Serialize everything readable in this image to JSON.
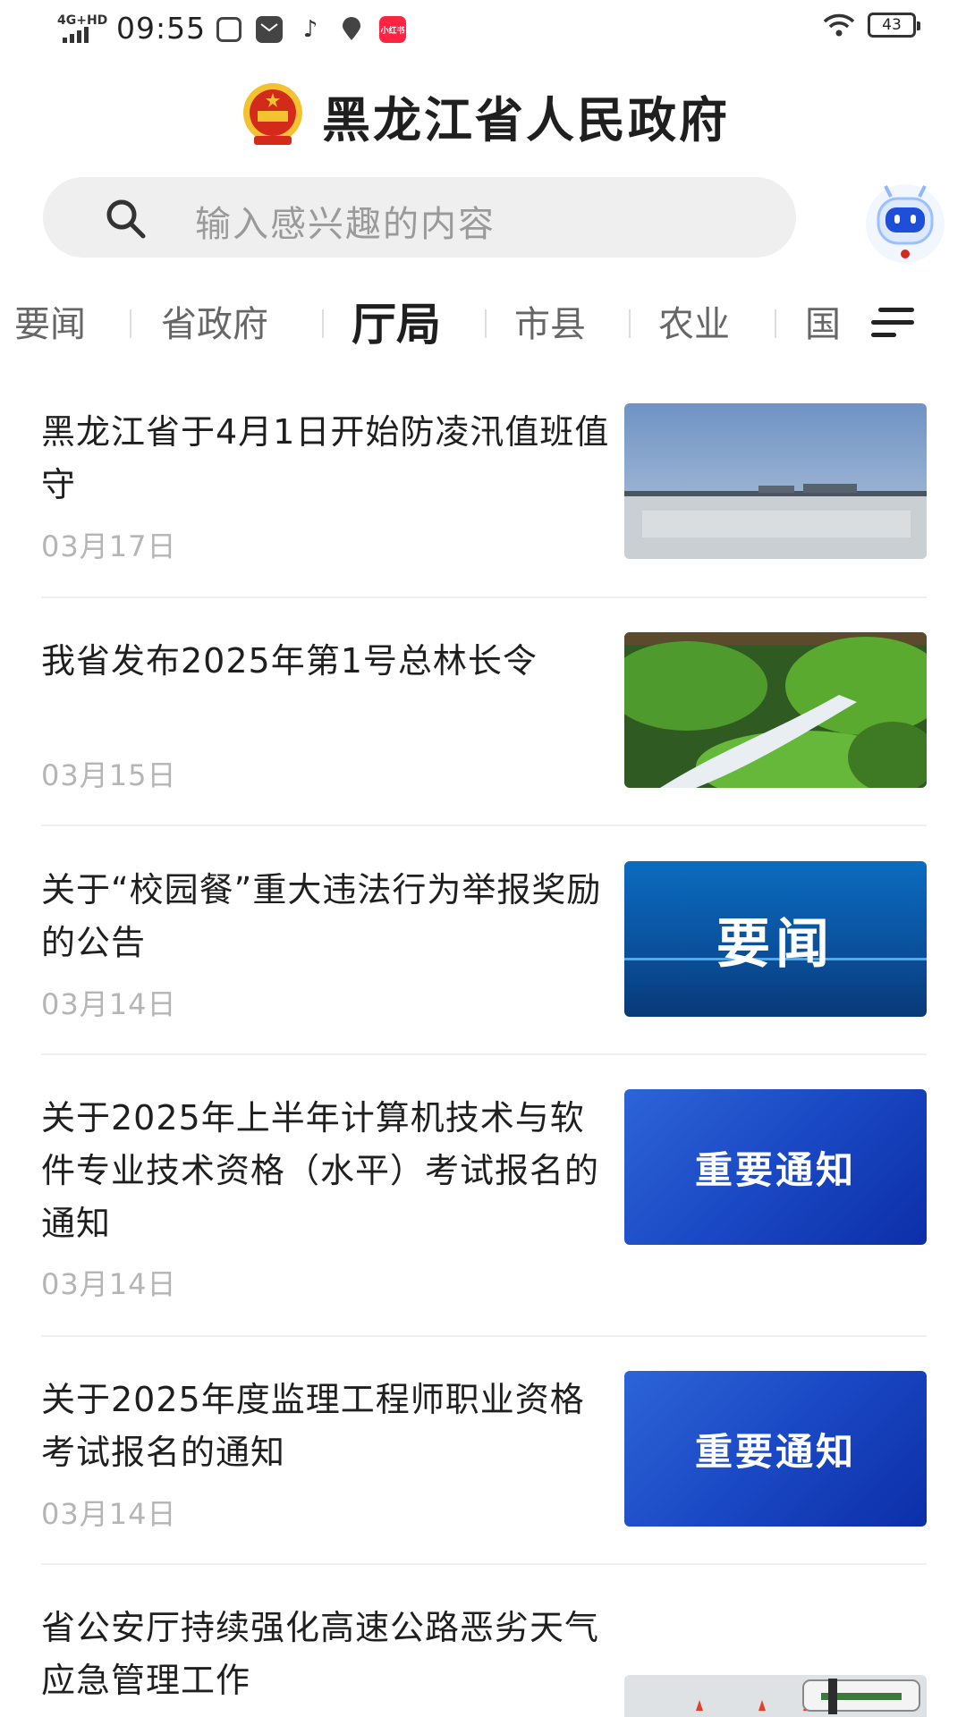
{
  "status_bar": {
    "network": "4G+HD",
    "time": "09:55",
    "notif_icons": [
      "weibo-like-icon",
      "mail-icon",
      "tiktok-icon",
      "location-chat-icon",
      "xiaohongshu-icon"
    ],
    "xhs_label": "小红书",
    "battery": "43"
  },
  "header": {
    "title": "黑龙江省人民政府"
  },
  "search": {
    "placeholder": "输入感兴趣的内容"
  },
  "tabs": [
    {
      "label": "要闻"
    },
    {
      "label": "省政府"
    },
    {
      "label": "厅局",
      "active": true
    },
    {
      "label": "市县"
    },
    {
      "label": "农业"
    },
    {
      "label": "国"
    }
  ],
  "news": [
    {
      "title": "黑龙江省于4月1日开始防凌汛值班值守",
      "date": "03月17日",
      "thumb": "frozen-river-photo"
    },
    {
      "title": "我省发布2025年第1号总林长令",
      "date": "03月15日",
      "thumb": "forest-stream-photo"
    },
    {
      "title": "关于“校园餐”重大违法行为举报奖励的公告",
      "date": "03月14日",
      "thumb_text": "要闻"
    },
    {
      "title": "关于2025年上半年计算机技术与软件专业技术资格（水平）考试报名的通知",
      "date": "03月14日",
      "thumb_text": "重要通知"
    },
    {
      "title": "关于2025年度监理工程师职业资格考试报名的通知",
      "date": "03月14日",
      "thumb_text": "重要通知"
    },
    {
      "title": "省公安厅持续强化高速公路恶劣天气应急管理工作",
      "date": "",
      "thumb": "snowy-road-police-photo"
    }
  ],
  "colors": {
    "accent_blue": "#1a48c4",
    "news_blue": "#0a5aa8",
    "emblem_red": "#d42a1c",
    "emblem_gold": "#f2c230"
  }
}
